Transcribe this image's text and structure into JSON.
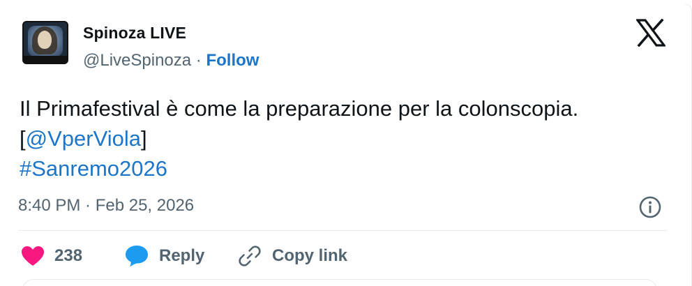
{
  "author": {
    "display_name": "Spinoza LIVE",
    "handle": "@LiveSpinoza",
    "separator": "·",
    "follow_label": "Follow"
  },
  "tweet": {
    "text_line1": "Il Primafestival è come la preparazione per la colonscopia.",
    "bracket_open": "[",
    "mention": "@VperViola",
    "bracket_close": "]",
    "hashtag": "#Sanremo2026",
    "timestamp": "8:40 PM · Feb 25, 2026"
  },
  "actions": {
    "like_count": "238",
    "reply_label": "Reply",
    "copy_link_label": "Copy link"
  },
  "colors": {
    "link": "#1d75c9",
    "like": "#f91880",
    "reply": "#1d9bf0",
    "muted": "#536471",
    "text": "#0f1419"
  },
  "icons": {
    "brand": "x-logo-icon",
    "info": "info-icon",
    "like": "heart-icon",
    "reply": "speech-bubble-icon",
    "copy": "link-icon"
  }
}
